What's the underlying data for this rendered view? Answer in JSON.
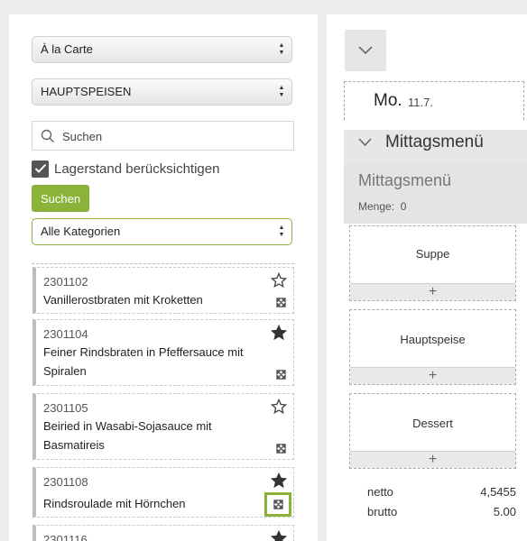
{
  "filters": {
    "menu_select": "À la Carte",
    "category_group_select": "HAUPTSPEISEN",
    "search_placeholder": "Suchen",
    "stock_checkbox_label": "Lagerstand berücksichtigen",
    "stock_checked": true,
    "search_button": "Suchen",
    "category_select": "Alle Kategorien"
  },
  "articles": [
    {
      "number": "2301102",
      "name": "Vanillerostbraten mit Kroketten",
      "favorite": false
    },
    {
      "number": "2301104",
      "name": "Feiner Rindsbraten in Pfeffersauce mit Spiralen",
      "favorite": true
    },
    {
      "number": "2301105",
      "name": "Beiried in Wasabi-Sojasauce mit Basmatireis",
      "favorite": false
    },
    {
      "number": "2301108",
      "name": "Rindsroulade mit Hörnchen",
      "favorite": true
    },
    {
      "number": "2301116",
      "name": "",
      "favorite": true
    }
  ],
  "day": {
    "weekday": "Mo.",
    "date": "11.7."
  },
  "menu": {
    "header": "Mittagsmenü",
    "title": "Mittagsmenü",
    "quantity_label": "Menge:",
    "quantity": "0",
    "courses": [
      "Suppe",
      "Hauptspeise",
      "Dessert"
    ],
    "add_symbol": "+"
  },
  "totals": {
    "netto_label": "netto",
    "netto": "4,5455",
    "brutto_label": "brutto",
    "brutto": "5.00"
  }
}
